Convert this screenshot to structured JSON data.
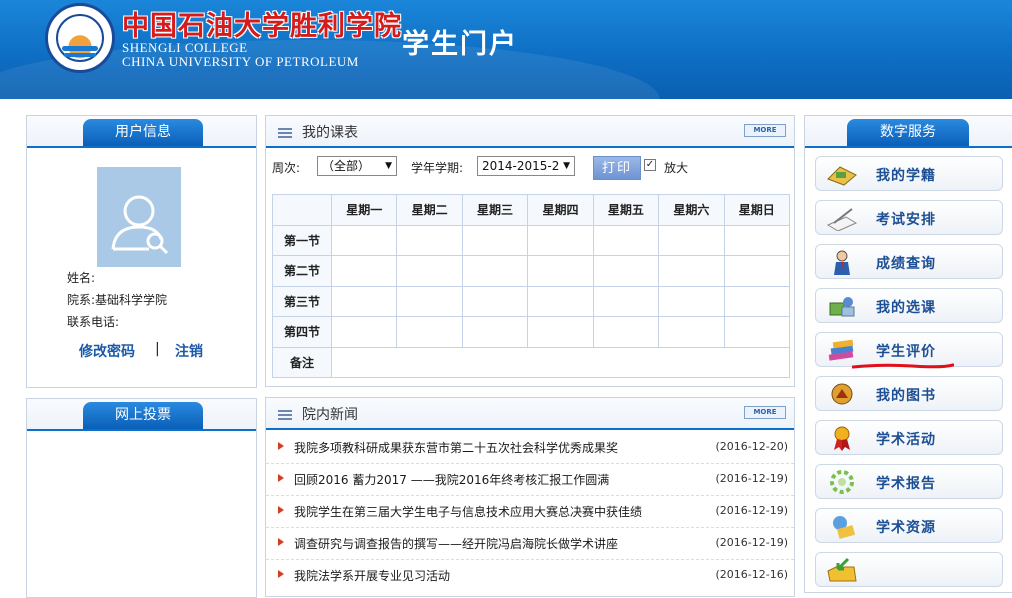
{
  "header": {
    "school_cn": "中国石油大学胜利学院",
    "school_en_line1": "SHENGLI COLLEGE",
    "school_en_line2": "CHINA UNIVERSITY OF PETROLEUM",
    "portal_title": "学生门户"
  },
  "user_info": {
    "title": "用户信息",
    "name_label": "姓名:",
    "dept_label": "院系:",
    "dept_value": "基础科学学院",
    "phone_label": "联系电话:",
    "change_password": "修改密码",
    "separator": "|",
    "logout": "注销"
  },
  "vote": {
    "title": "网上投票"
  },
  "schedule": {
    "title": "我的课表",
    "more": "MORE",
    "week_label": "周次:",
    "week_value": "（全部）",
    "term_label": "学年学期:",
    "term_value": "2014-2015-2",
    "print_label": "打印",
    "enlarge_label": "放大",
    "enlarge_checked": true,
    "days": [
      "星期一",
      "星期二",
      "星期三",
      "星期四",
      "星期五",
      "星期六",
      "星期日"
    ],
    "rows": [
      "第一节",
      "第二节",
      "第三节",
      "第四节",
      "备注"
    ]
  },
  "news": {
    "title": "院内新闻",
    "more": "MORE",
    "items": [
      {
        "title": "我院多项教科研成果获东营市第二十五次社会科学优秀成果奖",
        "date": "(2016-12-20)"
      },
      {
        "title": "回顾2016 蓄力2017 ——我院2016年终考核汇报工作圆满",
        "date": "(2016-12-19)"
      },
      {
        "title": "我院学生在第三届大学生电子与信息技术应用大赛总决赛中获佳绩",
        "date": "(2016-12-19)"
      },
      {
        "title": "调查研究与调查报告的撰写——经开院冯启海院长做学术讲座",
        "date": "(2016-12-19)"
      },
      {
        "title": "我院法学系开展专业见习活动",
        "date": "(2016-12-16)"
      }
    ]
  },
  "digital_services": {
    "title": "数字服务",
    "items": [
      {
        "label": "我的学籍",
        "icon": "id-card-icon"
      },
      {
        "label": "考试安排",
        "icon": "pen-paper-icon"
      },
      {
        "label": "成绩查询",
        "icon": "person-icon"
      },
      {
        "label": "我的选课",
        "icon": "course-select-icon"
      },
      {
        "label": "学生评价",
        "icon": "books-icon"
      },
      {
        "label": "我的图书",
        "icon": "library-icon"
      },
      {
        "label": "学术活动",
        "icon": "award-medal-icon"
      },
      {
        "label": "学术报告",
        "icon": "gear-report-icon"
      },
      {
        "label": "学术资源",
        "icon": "resource-icon"
      },
      {
        "label": "",
        "icon": "inbox-arrow-icon"
      }
    ]
  },
  "colors": {
    "header_blue": "#0e6fc4",
    "accent_blue": "#1c4f94",
    "annotation_red": "#e0101a"
  }
}
